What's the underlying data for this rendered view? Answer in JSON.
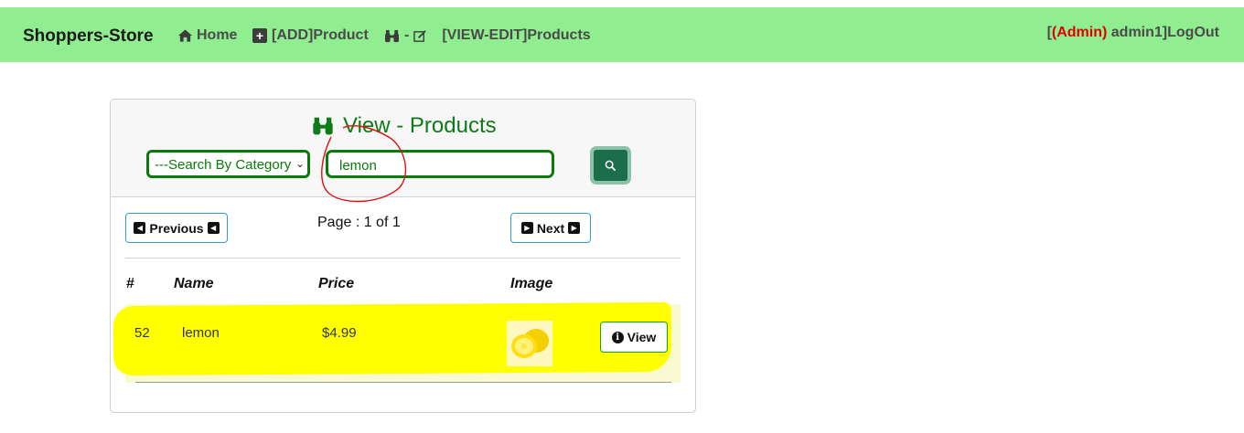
{
  "navbar": {
    "brand": "Shoppers-Store",
    "home": "Home",
    "add_product": "[ADD]Product",
    "view_edit": "[VIEW-EDIT]Products",
    "user_prefix": "[",
    "user_role": "(Admin)",
    "user_name": " admin1]",
    "logout": "LogOut",
    "bg_color": "#90ee90"
  },
  "card": {
    "title": "View - Products",
    "category_select": "---Search By Category",
    "search_value": "lemon",
    "prev_label": "Previous",
    "next_label": "Next",
    "page_info": "Page : 1 of 1"
  },
  "table": {
    "headers": [
      "#",
      "Name",
      "Price",
      "Image"
    ],
    "rows": [
      {
        "id": "52",
        "name": "lemon",
        "price": "$4.99",
        "view_label": "View"
      }
    ]
  },
  "colors": {
    "accent_green": "#0a7a0a",
    "search_btn": "#1b6e4c",
    "highlight": "#ffff00",
    "admin_red": "#e00000"
  },
  "icons": [
    "home-icon",
    "plus-square-icon",
    "binoculars-icon",
    "edit-icon",
    "search-icon",
    "caret-left-icon",
    "caret-right-icon",
    "info-circle-icon"
  ]
}
